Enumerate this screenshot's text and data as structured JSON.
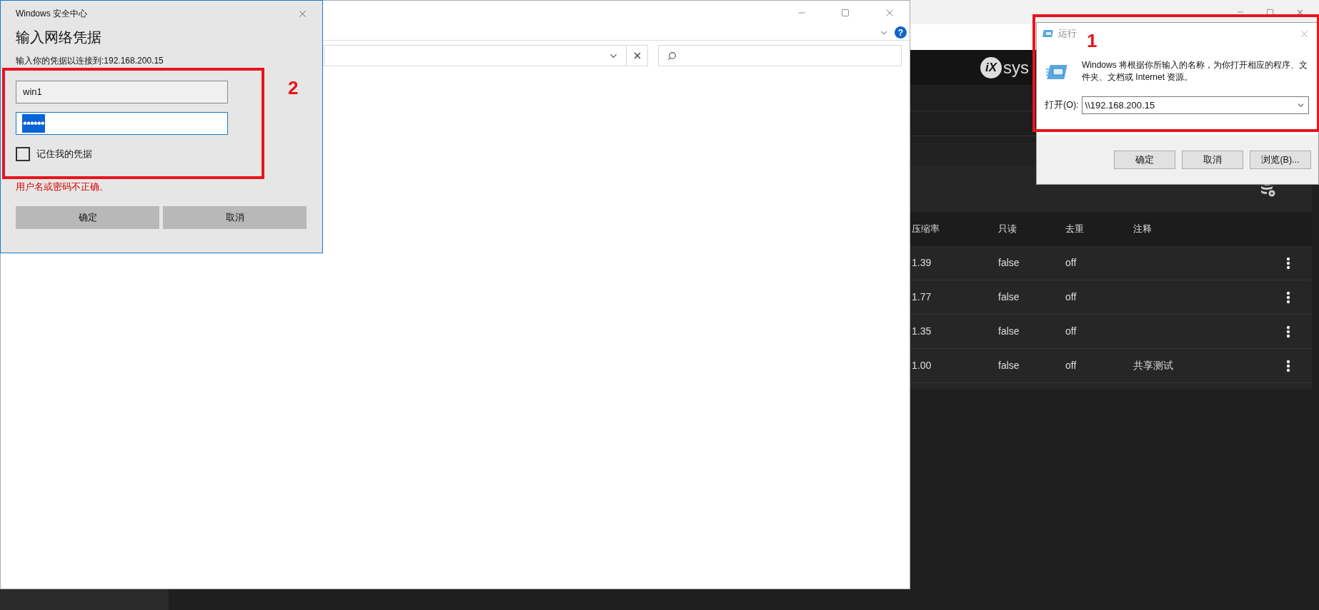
{
  "web_page": {
    "logo": {
      "mark": "iX",
      "text": "sys"
    },
    "table": {
      "columns": [
        "压缩率",
        "只读",
        "去重",
        "注释"
      ],
      "rows": [
        {
          "ratio": "1.39",
          "readonly": "false",
          "dedup": "off"
        },
        {
          "ratio": "1.77",
          "readonly": "false",
          "dedup": "off"
        },
        {
          "ratio": "1.35",
          "readonly": "false",
          "dedup": "off"
        },
        {
          "ratio": "1.00",
          "readonly": "false",
          "dedup": "off",
          "comment": "共享测试"
        }
      ]
    }
  },
  "explorer": {
    "help_glyph": "?"
  },
  "credential_dialog": {
    "title": "Windows 安全中心",
    "heading": "输入网络凭据",
    "prompt": "输入你的凭据以连接到:192.168.200.15",
    "annotation": "2",
    "username": {
      "value": "win1"
    },
    "password": {
      "value": "••••••",
      "selected": true
    },
    "remember": {
      "label": "记住我的凭据",
      "checked": false
    },
    "error": "用户名或密码不正确。",
    "buttons": [
      "确定",
      "取消"
    ]
  },
  "run_dialog": {
    "title": "运行",
    "annotation": "1",
    "description": "Windows 将根据你所输入的名称，为你打开相应的程序、文件夹、文档或 Internet 资源。",
    "open_label": "打开(O):",
    "open_value": "\\\\192.168.200.15",
    "buttons": [
      "确定",
      "取消",
      "浏览(B)..."
    ]
  }
}
